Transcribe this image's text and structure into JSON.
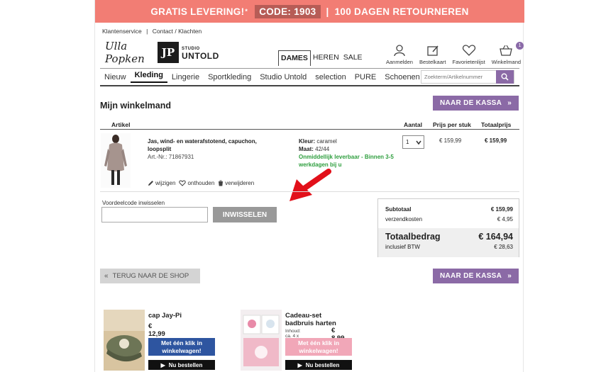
{
  "promo": {
    "text1": "GRATIS LEVERING!",
    "sup": "*",
    "code": "CODE: 1903",
    "sep": "|",
    "text2": "100 DAGEN RETOURNEREN"
  },
  "toplinks": {
    "service": "Klantenservice",
    "sep": "|",
    "contact": "Contact / Klachten"
  },
  "logos": {
    "ulla": "Ulla Popken",
    "jp": "JP",
    "untold_top": "STUDIO",
    "untold": "UNTOLD"
  },
  "gender": [
    "DAMES",
    "HEREN",
    "SALE"
  ],
  "usericons": [
    {
      "label": "Aanmelden",
      "icon": "user-icon"
    },
    {
      "label": "Bestelkaart",
      "icon": "order-card-icon"
    },
    {
      "label": "Favorietenlijst",
      "icon": "heart-icon"
    },
    {
      "label": "Winkelmand",
      "icon": "basket-icon",
      "badge": "1"
    }
  ],
  "nav": [
    "Nieuw",
    "Kleding",
    "Lingerie",
    "Sportkleding",
    "Studio Untold",
    "selection",
    "PURE",
    "Schoenen"
  ],
  "search": {
    "placeholder": "Zoekterm/Artikelnummer"
  },
  "cart": {
    "title": "Mijn winkelmand",
    "checkout": "NAAR DE KASSA",
    "chev": "»",
    "headers": {
      "artikel": "Artikel",
      "aantal": "Aantal",
      "prijs": "Prijs per stuk",
      "totaal": "Totaalprijs"
    },
    "item": {
      "name": "Jas, wind- en waterafstotend, capuchon, loopsplit",
      "artnr": "Art.-Nr.: 71867931",
      "kleur_label": "Kleur:",
      "kleur": "caramel",
      "maat_label": "Maat:",
      "maat": "42/44",
      "availability": "Onmiddellijk leverbaar - Binnen 3-5 werkdagen bij u",
      "qty": "1",
      "price": "€ 159,99",
      "total": "€ 159,99",
      "actions": [
        "wijzigen",
        "onthouden",
        "verwijderen"
      ]
    },
    "voucher": {
      "label": "Voordeelcode inwisselen",
      "button": "INWISSELEN",
      "value": ""
    },
    "summary": {
      "subtotal_label": "Subtotaal",
      "subtotal": "€ 159,99",
      "shipping_label": "verzendkosten",
      "shipping": "€ 4,95",
      "total_label": "Totaalbedrag",
      "total": "€ 164,94",
      "vat_label": "inclusief BTW",
      "vat": "€ 28,63"
    },
    "back": "TERUG NAAR DE SHOP",
    "back_chev": "«"
  },
  "recommendations": [
    {
      "title": "cap Jay-Pi",
      "price": "€ 12,99",
      "klik": "Met één klik in winkelwagen!",
      "now": "Nu bestellen",
      "color": "#2e55a0"
    },
    {
      "title": "Cadeau-set badbruis harten",
      "inhoud": "Inhoud: ca. 4 x 80 g",
      "price": "€ 8,99",
      "klik": "Met één klik in winkelwagen!",
      "now": "Nu bestellen",
      "color": "#f1a7b8"
    }
  ]
}
